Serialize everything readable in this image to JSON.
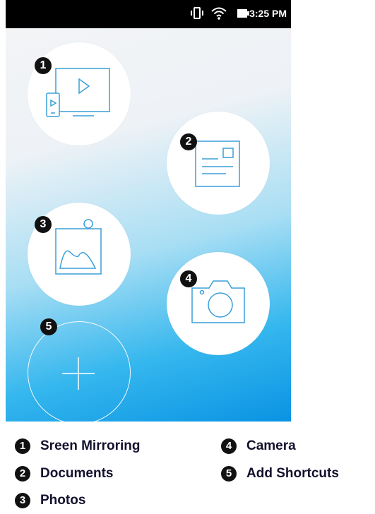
{
  "status_bar": {
    "time": "3:25 PM",
    "icons": [
      "vibrate-icon",
      "wifi-icon",
      "battery-icon"
    ]
  },
  "shortcuts": [
    {
      "number": "1",
      "label": "Sreen Mirroring",
      "icon": "screen-mirroring-icon"
    },
    {
      "number": "2",
      "label": "Documents",
      "icon": "document-icon"
    },
    {
      "number": "3",
      "label": "Photos",
      "icon": "photo-icon"
    },
    {
      "number": "4",
      "label": "Camera",
      "icon": "camera-icon"
    },
    {
      "number": "5",
      "label": "Add Shortcuts",
      "icon": "plus-icon"
    }
  ],
  "colors": {
    "icon_stroke": "#3a9fd8",
    "gradient_top": "#f3f4f6",
    "gradient_bottom": "#0a93e3",
    "label_text": "#13112d",
    "badge": "#111111"
  }
}
